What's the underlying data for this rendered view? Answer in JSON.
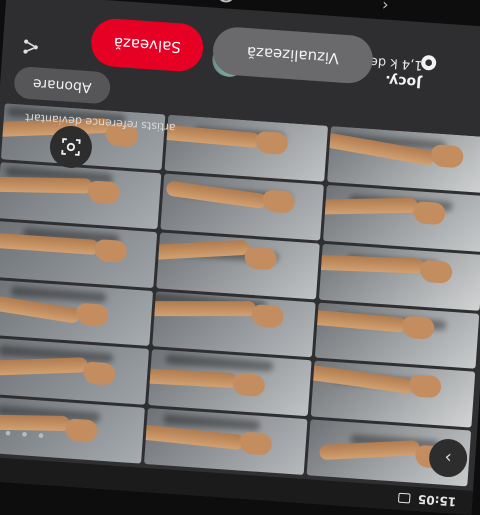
{
  "status_bar": {
    "time": "15:05"
  },
  "content": {
    "site_link": "artists reference deviantart",
    "tiles": 18
  },
  "pin": {
    "follow_button_label": "Abonare",
    "username": "Jocy.",
    "followers": "1,4 k de abonați",
    "visualize_button_label": "Vizualizează",
    "save_button_label": "Salvează"
  },
  "colors": {
    "save_red": "#e60023",
    "panel_bg": "#2e2e30",
    "button_gray": "#6a6a6c"
  },
  "icons": {
    "scan": "lens-scan-icon",
    "share": "share-icon",
    "next": "chevron-right-icon",
    "more": "more-dots-icon",
    "brand": "brand-logo-icon"
  }
}
